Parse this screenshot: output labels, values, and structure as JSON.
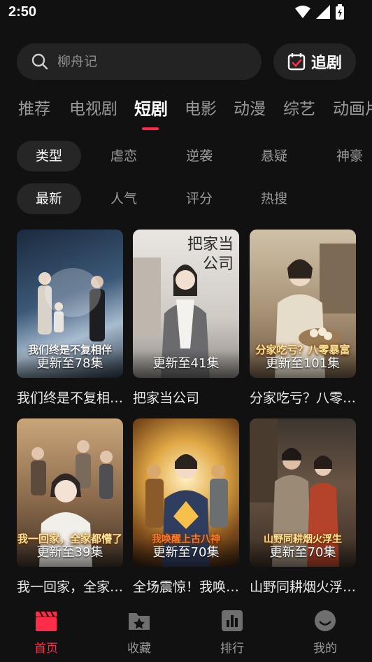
{
  "status": {
    "time": "2:50"
  },
  "search": {
    "placeholder": "柳舟记",
    "follow_label": "追剧"
  },
  "tabs": [
    {
      "label": "推荐",
      "active": false
    },
    {
      "label": "电视剧",
      "active": false
    },
    {
      "label": "短剧",
      "active": true
    },
    {
      "label": "电影",
      "active": false
    },
    {
      "label": "动漫",
      "active": false
    },
    {
      "label": "综艺",
      "active": false
    },
    {
      "label": "动画片",
      "active": false
    }
  ],
  "filters": {
    "genre": [
      "类型",
      "虐恋",
      "逆袭",
      "悬疑",
      "神豪"
    ],
    "sort": [
      "最新",
      "人气",
      "评分",
      "热搜"
    ]
  },
  "cards": [
    {
      "title": "我们终是不复相…",
      "episodes": "更新至78集",
      "cover_text": "我们终是不复相伴"
    },
    {
      "title": "把家当公司",
      "episodes": "更新至41集",
      "cover_text": "把家当公司"
    },
    {
      "title": "分家吃亏？八零…",
      "episodes": "更新至101集",
      "cover_text": "分家吃亏？八零暴富"
    },
    {
      "title": "我一回家，全家…",
      "episodes": "更新至39集",
      "cover_text": "我一回家，全家都懵了"
    },
    {
      "title": "全场震惊！我唤…",
      "episodes": "更新至70集",
      "cover_text": "我唤醒上古八神"
    },
    {
      "title": "山野同耕烟火浮…",
      "episodes": "更新至70集",
      "cover_text": "山野同耕烟火浮生"
    }
  ],
  "nav": [
    {
      "label": "首页",
      "icon": "clapperboard-icon",
      "active": true
    },
    {
      "label": "收藏",
      "icon": "star-folder-icon",
      "active": false
    },
    {
      "label": "排行",
      "icon": "bar-chart-icon",
      "active": false
    },
    {
      "label": "我的",
      "icon": "smile-face-icon",
      "active": false
    }
  ],
  "colors": {
    "accent": "#ff2d4a",
    "background": "#111111",
    "chip_bg": "#262626"
  }
}
